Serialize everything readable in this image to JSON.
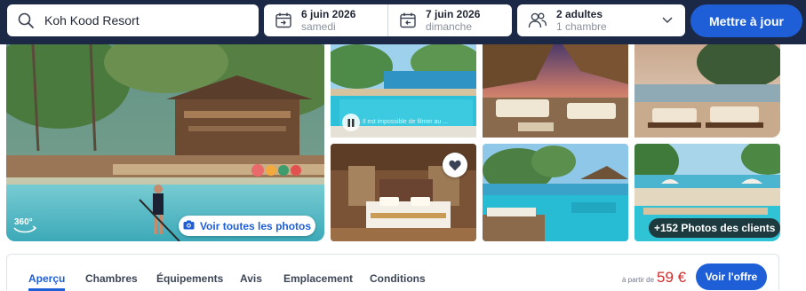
{
  "search": {
    "destination": "Koh Kood Resort",
    "checkin": {
      "date": "6 juin 2026",
      "day": "samedi"
    },
    "checkout": {
      "date": "7 juin 2026",
      "day": "dimanche"
    },
    "guests": {
      "adults": "2 adultes",
      "rooms": "1 chambre"
    },
    "update_label": "Mettre à jour"
  },
  "gallery": {
    "see_all_label": "Voir toutes les photos",
    "badge_360": "360°",
    "video_caption": "Il est impossible de filmer au ...",
    "client_photos_label": "+152 Photos des clients"
  },
  "nav": {
    "tabs": [
      {
        "label": "Aperçu",
        "active": true
      },
      {
        "label": "Chambres",
        "active": false
      },
      {
        "label": "Équipements",
        "active": false
      },
      {
        "label": "Avis",
        "active": false
      },
      {
        "label": "Emplacement",
        "active": false
      },
      {
        "label": "Conditions",
        "active": false
      }
    ],
    "price_prefix": "à partir de",
    "price": "59 €",
    "offer_label": "Voir l'offre"
  },
  "colors": {
    "header_bg": "#1c2946",
    "accent_blue": "#1e5fd8",
    "price_red": "#d12b2b"
  },
  "icons": [
    "search-icon",
    "calendar-checkin-icon",
    "calendar-checkout-icon",
    "guests-icon",
    "chevron-down-icon",
    "camera-icon",
    "360-view-icon",
    "pause-icon",
    "heart-icon"
  ]
}
